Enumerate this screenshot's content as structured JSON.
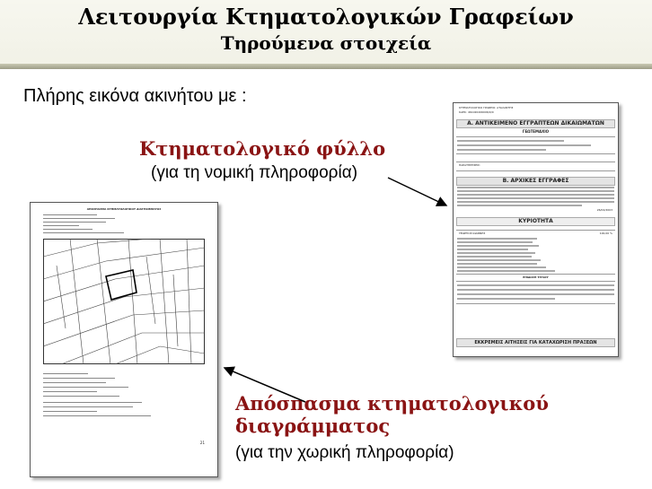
{
  "slide": {
    "title": "Λειτουργία Κτηματολογικών Γραφείων",
    "subtitle": "Τηρούμενα στοιχεία",
    "intro": "Πλήρης εικόνα ακινήτου με :",
    "item1_title": "Κτηματολογικό φύλλο",
    "item1_desc": "(για τη νομική πληροφορία)",
    "item2_title_line1": "Απόσπασμα κτηματολογικού",
    "item2_title_line2": "διαγράμματος",
    "item2_desc": "(για την χωρική πληροφορία)"
  },
  "sheet": {
    "header1": "ΚΤΗΜΑΤΟΛΟΓΙΚΟ ΓΡΑΦΕΙΟ: ΑΤΑΛΑΝΤΗΣ",
    "header2": "ΚΑΕΚ:",
    "header2_value": "461020206006/0/0",
    "section_a": "Α. ΑΝΤΙΚΕΙΜΕΝΟ ΕΓΓΡΑΠΤΕΩΝ ΔΙΚΑΙΩΜΑΤΩΝ",
    "section_a_sub": "ΓΕΩΤΕΜΑΧΙΟ",
    "remarks": "ΠΑΡΑΤΗΡΗΣΕΙΣ:",
    "section_b": "Β. ΑΡΧΙΚΕΣ ΕΓΓΡΑΦΕΣ",
    "date": "26/02/2003",
    "ownership": "ΚΥΡΙΟΤΗΤΑ",
    "owner": "ΓΕΩΡΓΙΟΣ ΙΩΑΝΝΗΣ",
    "share": "100,00 %",
    "title_doc": "ΕΠΙΔΟΣΗ ΤΙΤΛΟΥ",
    "footer_section": "ΕΚΚΡΕΜΕΙΣ ΑΙΤΗΣΕΙΣ ΓΙΑ ΚΑΤΑΧΩΡΙΣΗ ΠΡΑΞΕΩΝ"
  },
  "diagram": {
    "title": "ΑΠΟΣΠΑΣΜΑ ΚΤΗΜΑΤΟΛΟΓΙΚΟΥ ΔΙΑΓΡΑΜΜΑΤΟΣ",
    "page_number": "21"
  },
  "colors": {
    "accent": "#8a1414",
    "header_bg": "#f4f4ea",
    "rule": "#a8a892"
  }
}
